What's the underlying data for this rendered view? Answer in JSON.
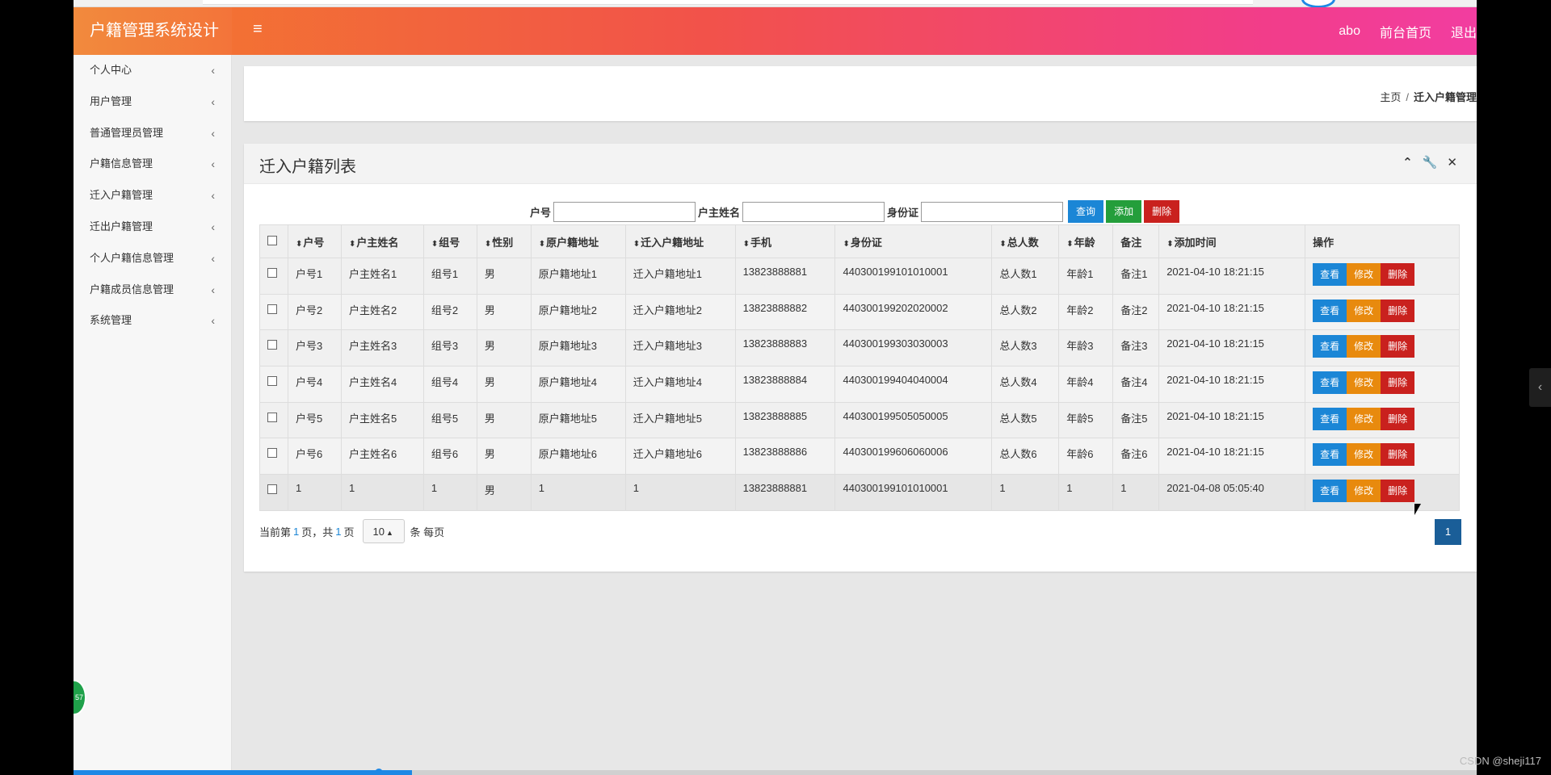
{
  "app": {
    "title": "户籍管理系统设计",
    "menu_icon": "≡",
    "header_links": [
      "abo",
      "前台首页",
      "退出"
    ]
  },
  "sidebar": {
    "items": [
      {
        "label": "个人中心"
      },
      {
        "label": "用户管理"
      },
      {
        "label": "普通管理员管理"
      },
      {
        "label": "户籍信息管理"
      },
      {
        "label": "迁入户籍管理"
      },
      {
        "label": "迁出户籍管理"
      },
      {
        "label": "个人户籍信息管理"
      },
      {
        "label": "户籍成员信息管理"
      },
      {
        "label": "系统管理"
      }
    ]
  },
  "breadcrumb": {
    "home": "主页",
    "separator": "/",
    "current": "迁入户籍管理"
  },
  "panel": {
    "title": "迁入户籍列表"
  },
  "search": {
    "fields": [
      {
        "label": "户号",
        "value": ""
      },
      {
        "label": "户主姓名",
        "value": ""
      },
      {
        "label": "身份证",
        "value": ""
      }
    ],
    "query_label": "查询",
    "add_label": "添加",
    "delete_label": "删除"
  },
  "table": {
    "columns": [
      "户号",
      "户主姓名",
      "组号",
      "性别",
      "原户籍地址",
      "迁入户籍地址",
      "手机",
      "身份证",
      "总人数",
      "年龄",
      "备注",
      "添加时间",
      "操作"
    ],
    "sortable": [
      true,
      true,
      true,
      true,
      true,
      true,
      true,
      true,
      true,
      true,
      false,
      true,
      false
    ],
    "rows": [
      [
        "户号1",
        "户主姓名1",
        "组号1",
        "男",
        "原户籍地址1",
        "迁入户籍地址1",
        "13823888881",
        "440300199101010001",
        "总人数1",
        "年龄1",
        "备注1",
        "2021-04-10 18:21:15"
      ],
      [
        "户号2",
        "户主姓名2",
        "组号2",
        "男",
        "原户籍地址2",
        "迁入户籍地址2",
        "13823888882",
        "440300199202020002",
        "总人数2",
        "年龄2",
        "备注2",
        "2021-04-10 18:21:15"
      ],
      [
        "户号3",
        "户主姓名3",
        "组号3",
        "男",
        "原户籍地址3",
        "迁入户籍地址3",
        "13823888883",
        "440300199303030003",
        "总人数3",
        "年龄3",
        "备注3",
        "2021-04-10 18:21:15"
      ],
      [
        "户号4",
        "户主姓名4",
        "组号4",
        "男",
        "原户籍地址4",
        "迁入户籍地址4",
        "13823888884",
        "440300199404040004",
        "总人数4",
        "年龄4",
        "备注4",
        "2021-04-10 18:21:15"
      ],
      [
        "户号5",
        "户主姓名5",
        "组号5",
        "男",
        "原户籍地址5",
        "迁入户籍地址5",
        "13823888885",
        "440300199505050005",
        "总人数5",
        "年龄5",
        "备注5",
        "2021-04-10 18:21:15"
      ],
      [
        "户号6",
        "户主姓名6",
        "组号6",
        "男",
        "原户籍地址6",
        "迁入户籍地址6",
        "13823888886",
        "440300199606060006",
        "总人数6",
        "年龄6",
        "备注6",
        "2021-04-10 18:21:15"
      ],
      [
        "1",
        "1",
        "1",
        "男",
        "1",
        "1",
        "13823888881",
        "440300199101010001",
        "1",
        "1",
        "1",
        "2021-04-08 05:05:40"
      ]
    ],
    "row_actions": {
      "view": "查看",
      "edit": "修改",
      "delete": "删除"
    }
  },
  "pagination": {
    "prefix": "当前第",
    "current_page": "1",
    "middle": "页，共",
    "total_pages": "1",
    "suffix": "页",
    "page_size": "10",
    "page_size_suffix": "条 每页",
    "page_button": "1"
  },
  "overlay": {
    "bubble_text": "57",
    "watermark": "CSDN @sheji117",
    "video_progress": 0.241
  },
  "colors": {
    "header_start": "#f37b2c",
    "header_end": "#f23da0",
    "primary": "#1b86d6",
    "success": "#249e3b",
    "danger": "#c9211e",
    "warning": "#e88a0e",
    "page_active": "#1a5e98"
  }
}
